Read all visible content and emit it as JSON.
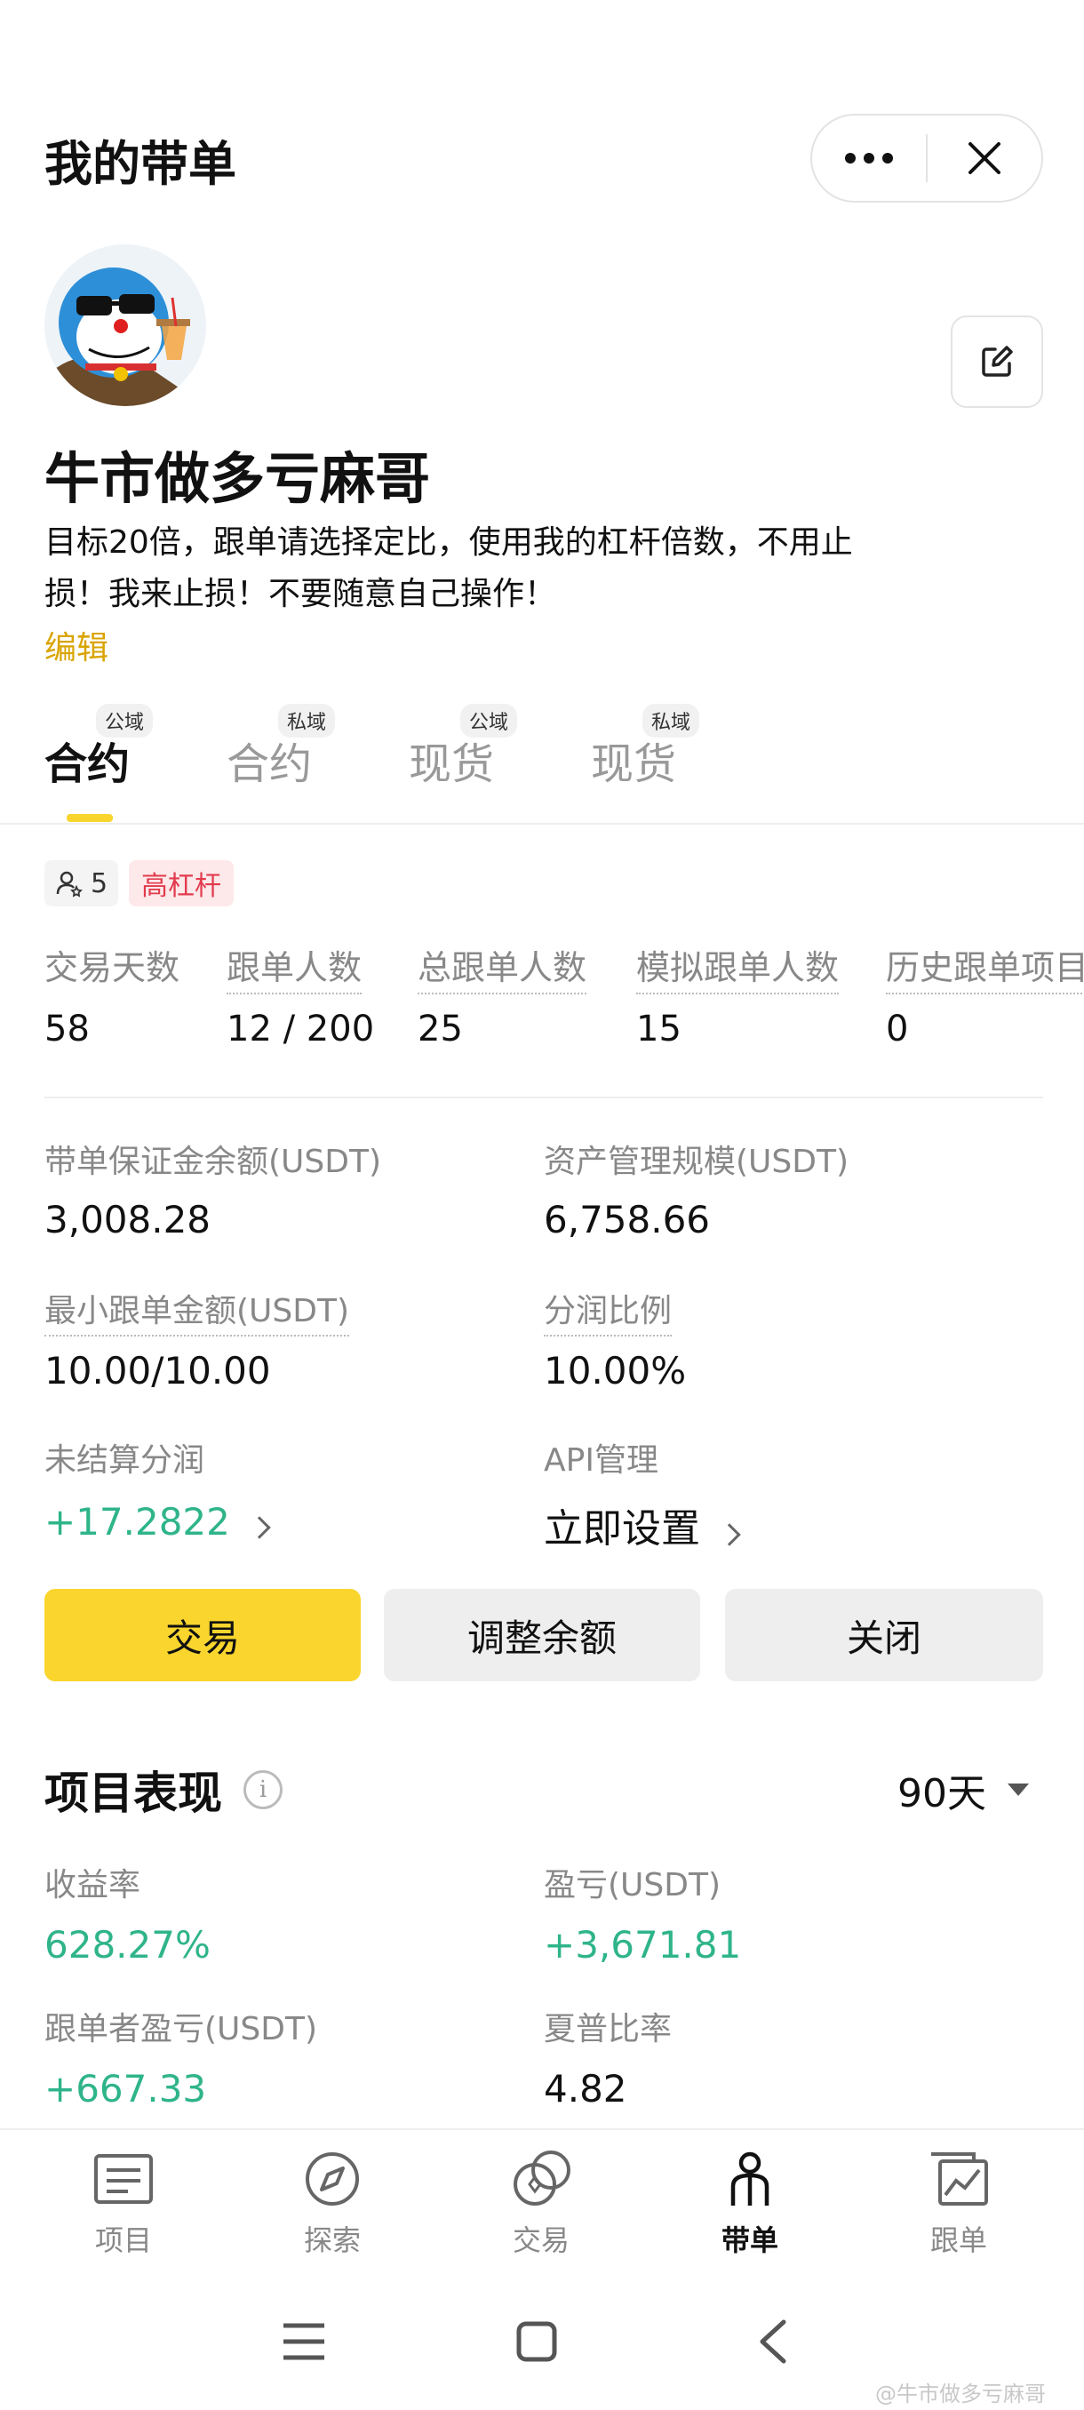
{
  "header": {
    "title": "我的带单"
  },
  "icons": {
    "more": "more-dots-icon",
    "close": "close-icon",
    "edit": "edit-icon",
    "info": "info-icon"
  },
  "profile": {
    "nickname": "牛市做多亏麻哥",
    "bio_line1": "目标20倍，跟单请选择定比，使用我的杠杆倍数，不用止",
    "bio_line2": "损！我来止损！不要随意自己操作！",
    "edit_label": "编辑"
  },
  "tabs": [
    {
      "label": "合约",
      "badge": "公域",
      "active": true
    },
    {
      "label": "合约",
      "badge": "私域",
      "active": false
    },
    {
      "label": "现货",
      "badge": "公域",
      "active": false
    },
    {
      "label": "现货",
      "badge": "私域",
      "active": false
    }
  ],
  "chips": {
    "followers": "5",
    "leverage": "高杠杆"
  },
  "stats": [
    {
      "label": "交易天数",
      "value": "58"
    },
    {
      "label": "跟单人数",
      "value": "12 / 200"
    },
    {
      "label": "总跟单人数",
      "value": "25"
    },
    {
      "label": "模拟跟单人数",
      "value": "15"
    },
    {
      "label": "历史跟单项目",
      "value": "0"
    }
  ],
  "account": {
    "margin_balance_label": "带单保证金余额(USDT)",
    "margin_balance": "3,008.28",
    "aum_label": "资产管理规模(USDT)",
    "aum": "6,758.66",
    "min_amount_label": "最小跟单金额(USDT)",
    "min_amount": "10.00/10.00",
    "profit_share_label": "分润比例",
    "profit_share": "10.00%",
    "unsettled_label": "未结算分润",
    "unsettled": "+17.2822",
    "api_label": "API管理",
    "api_action": "立即设置"
  },
  "actions": {
    "trade": "交易",
    "adjust": "调整余额",
    "close": "关闭"
  },
  "performance": {
    "title": "项目表现",
    "period": "90天",
    "roi_label": "收益率",
    "roi": "628.27%",
    "pnl_label": "盈亏(USDT)",
    "pnl": "+3,671.81",
    "follower_pnl_label": "跟单者盈亏(USDT)",
    "follower_pnl": "+667.33",
    "sharpe_label": "夏普比率",
    "sharpe": "4.82"
  },
  "nav": [
    {
      "label": "项目",
      "icon": "list-icon"
    },
    {
      "label": "探索",
      "icon": "compass-icon"
    },
    {
      "label": "交易",
      "icon": "trade-icon"
    },
    {
      "label": "带单",
      "icon": "person-icon",
      "active": true
    },
    {
      "label": "跟单",
      "icon": "chart-icon"
    }
  ],
  "watermark": "@牛市做多亏麻哥",
  "colors": {
    "accent": "#f9d52d",
    "positive": "#2fb48a",
    "tag_red": "#e23b4d",
    "link": "#d9a400"
  }
}
